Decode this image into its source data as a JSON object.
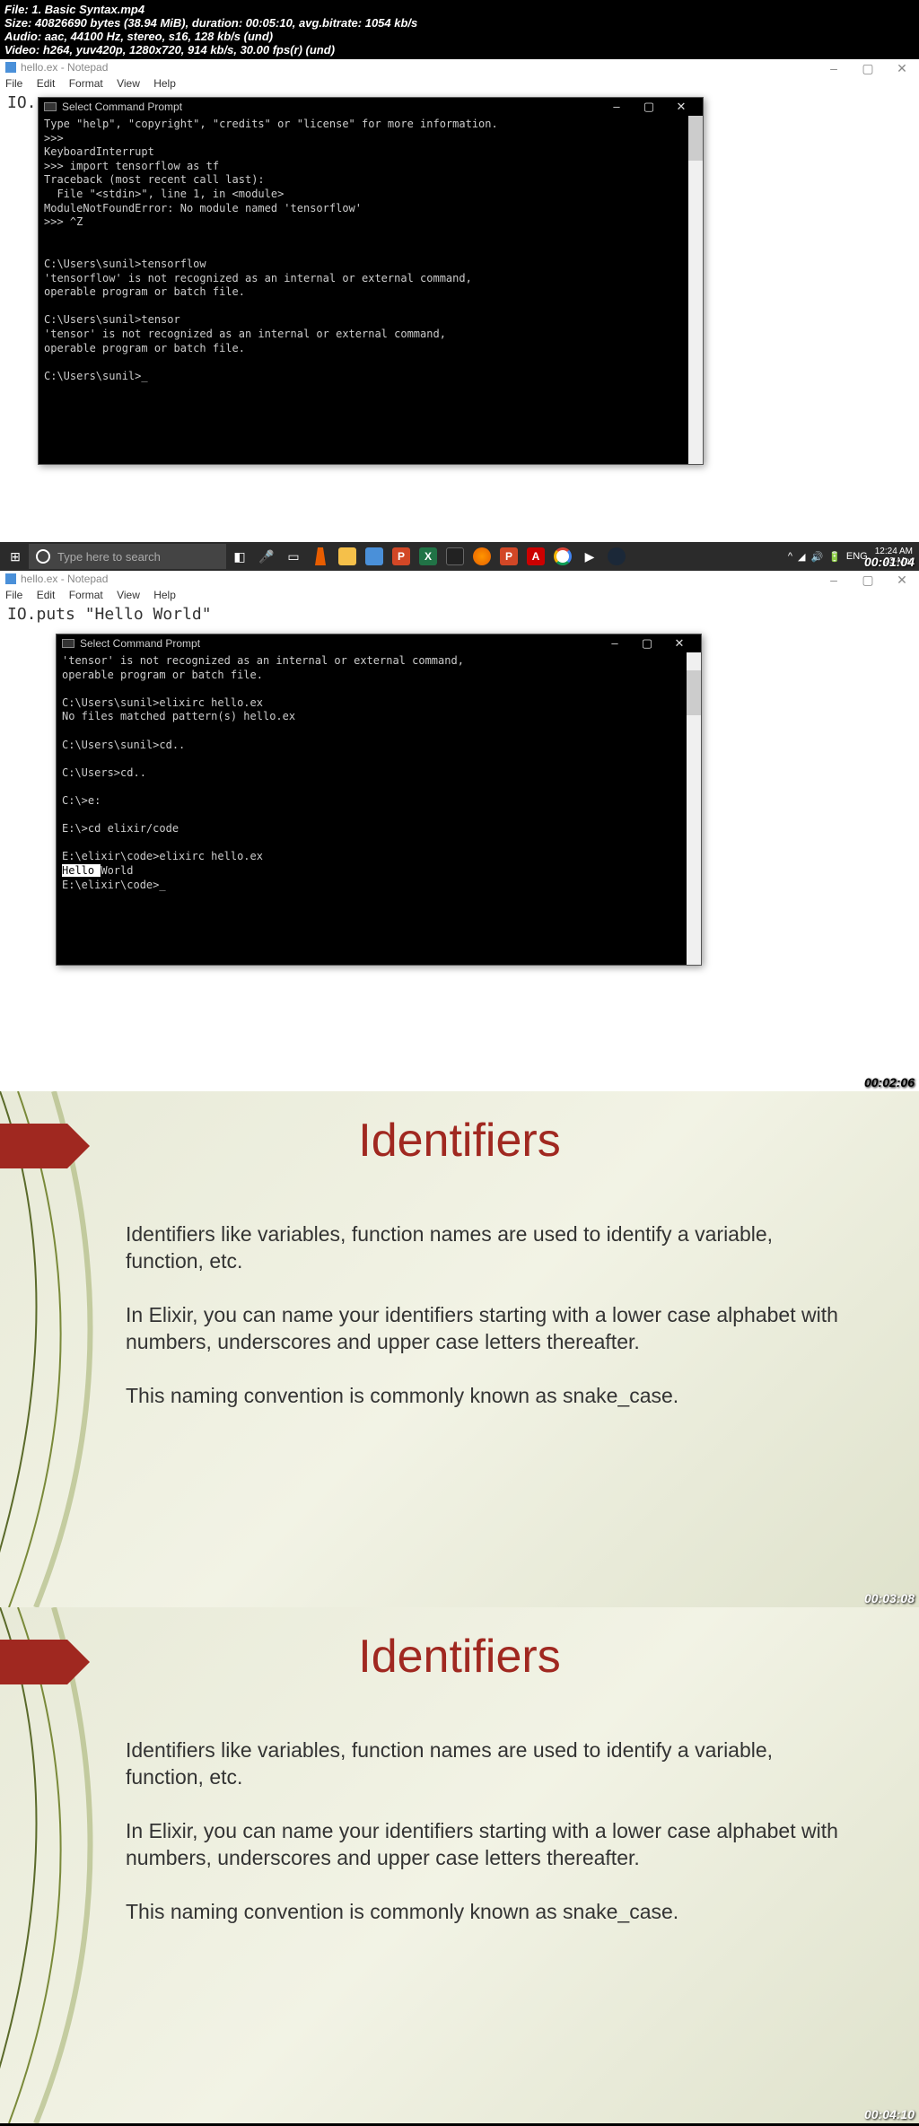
{
  "metadata": {
    "file_line": "File: 1. Basic Syntax.mp4",
    "size_line": "Size: 40826690 bytes (38.94 MiB), duration: 00:05:10, avg.bitrate: 1054 kb/s",
    "audio_line": "Audio: aac, 44100 Hz, stereo, s16, 128 kb/s (und)",
    "video_line": "Video: h264, yuv420p, 1280x720, 914 kb/s, 30.00 fps(r) (und)"
  },
  "frame1": {
    "notepad_title": "hello.ex - Notepad",
    "menu": {
      "file": "File",
      "edit": "Edit",
      "format": "Format",
      "view": "View",
      "help": "Help"
    },
    "code_line": "IO.pu",
    "cmd_title": "Select Command Prompt",
    "cmd_text": "Type \"help\", \"copyright\", \"credits\" or \"license\" for more information.\n>>>\nKeyboardInterrupt\n>>> import tensorflow as tf\nTraceback (most recent call last):\n  File \"<stdin>\", line 1, in <module>\nModuleNotFoundError: No module named 'tensorflow'\n>>> ^Z\n\n\nC:\\Users\\sunil>tensorflow\n'tensorflow' is not recognized as an internal or external command,\noperable program or batch file.\n\nC:\\Users\\sunil>tensor\n'tensor' is not recognized as an internal or external command,\noperable program or batch file.\n\nC:\\Users\\sunil>_",
    "taskbar": {
      "search_placeholder": "Type here to search",
      "lang": "ENG",
      "time": "12:24 AM",
      "date": "23-Mar"
    },
    "timestamp": "00:01:04"
  },
  "frame2": {
    "notepad_title": "hello.ex - Notepad",
    "menu": {
      "file": "File",
      "edit": "Edit",
      "format": "Format",
      "view": "View",
      "help": "Help"
    },
    "code_line": "IO.puts \"Hello World\"",
    "cmd_title": "Select Command Prompt",
    "cmd_text": "'tensor' is not recognized as an internal or external command,\noperable program or batch file.\n\nC:\\Users\\sunil>elixirc hello.ex\nNo files matched pattern(s) hello.ex\n\nC:\\Users\\sunil>cd..\n\nC:\\Users>cd..\n\nC:\\>e:\n\nE:\\>cd elixir/code\n\nE:\\elixir\\code>elixirc hello.ex",
    "cmd_hello": "Hello ",
    "cmd_world": "World",
    "cmd_text2": "\nE:\\elixir\\code>_",
    "timestamp": "00:02:06"
  },
  "frame3": {
    "title": "Identifiers",
    "p1": "Identifiers like variables, function names are used to identify a variable, function, etc.",
    "p2": "In Elixir, you can name your identifiers starting with a lower case alphabet with numbers, underscores and upper case letters thereafter.",
    "p3": "This naming convention is commonly known as snake_case.",
    "timestamp": "00:03:08"
  },
  "frame4": {
    "title": "Identifiers",
    "p1": "Identifiers like variables, function names are used to identify a variable, function, etc.",
    "p2": "In Elixir, you can name your identifiers starting with a lower case alphabet with numbers, underscores and upper case letters thereafter.",
    "p3": "This naming convention is commonly known as snake_case.",
    "timestamp": "00:04:10"
  }
}
